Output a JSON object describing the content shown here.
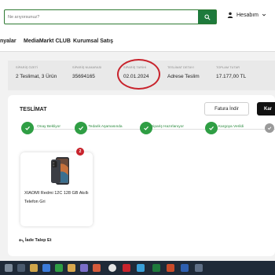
{
  "header": {
    "search_placeholder": "Ne arıyorsunuz?",
    "search_icon": "search-icon",
    "account_label": "Hesabım",
    "account_icon": "user-icon",
    "account_chevron": "chevron-down-icon"
  },
  "nav": {
    "items": [
      "nyalar",
      "MediaMarkt CLUB",
      "Kurumsal Satış"
    ]
  },
  "summary": {
    "columns": [
      {
        "label": "SİPARİŞ ÖZETİ",
        "value": "2 Teslimat, 3 Ürün"
      },
      {
        "label": "SİPARİŞ NUMARASI",
        "value": "35694165"
      },
      {
        "label": "SİPARİŞ TARİHİ",
        "value": "02.01.2024"
      },
      {
        "label": "TESLİMAT DETAYI",
        "value": "Adrese Teslim"
      },
      {
        "label": "TOPLAM TUTAR",
        "value": "17.177,00 TL"
      }
    ],
    "highlight_color": "#c8232c"
  },
  "delivery": {
    "title": "TESLİMAT",
    "invoice_button": "Fatura İndir",
    "dark_button": "Kar",
    "steps": [
      {
        "label": "Onay Bekliyor",
        "status": "done"
      },
      {
        "label": "Tedarik Aşamasında",
        "status": "done"
      },
      {
        "label": "Sipariş Hazırlanıyor",
        "status": "done"
      },
      {
        "label": "Kargoya Verildi",
        "status": "done"
      },
      {
        "label": "",
        "status": "pending"
      }
    ],
    "product": {
      "name": "XIAOMI Redmi 12C 128 GB Akıllı Telefon Gri",
      "quantity": "2"
    },
    "return_label": "İade Talep Et"
  },
  "colors": {
    "accent_green": "#2f9e44",
    "brand_red": "#c8232c",
    "search_button": "#1e7a3c",
    "taskbar": "#1f2a38"
  }
}
